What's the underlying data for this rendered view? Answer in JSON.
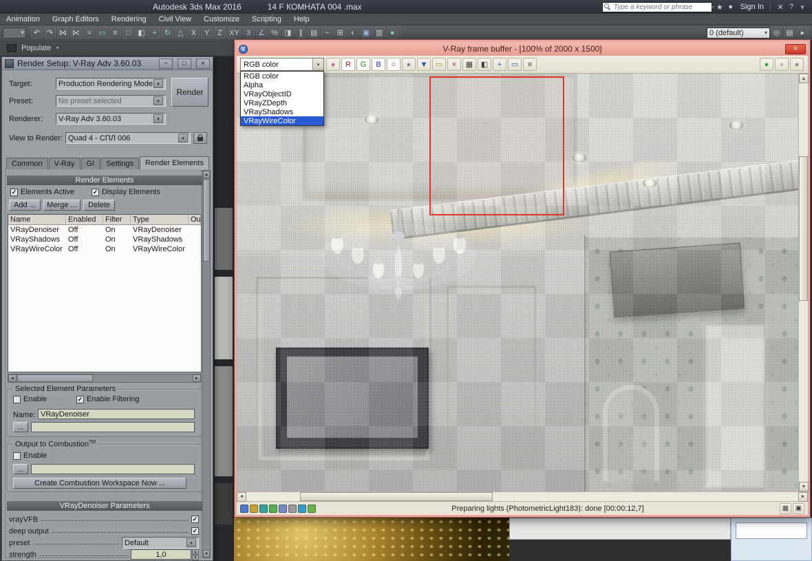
{
  "glyphs": {
    "up": "▲",
    "down": "▼",
    "left": "◄",
    "right": "►",
    "caret": "▾",
    "small_up": "▴",
    "small_down": "▾",
    "check": "✓",
    "minimize": "−",
    "maximize": "□",
    "close": "×"
  },
  "accent_colors": {
    "vfb_frame": "#e7a79e",
    "vfb_titlebar": "#f0aea4",
    "list_highlight": "#2a5ad4",
    "region_outline": "#e23424",
    "close_button": "#d8402e"
  },
  "app": {
    "titlebar": {
      "app_title": "Autodesk 3ds Max 2016",
      "file_title": "14  F КОМНАТА 004 .max",
      "search_placeholder": "Type a keyword or phrase",
      "sign_in": "Sign In",
      "account_icons": [
        {
          "name": "favorites-star-icon",
          "glyph": "★",
          "color": "#c8cdd2"
        },
        {
          "name": "user-icon",
          "glyph": "●",
          "color": "#c8cdd2"
        }
      ],
      "far_icons": [
        {
          "name": "autodesk-a360-icon",
          "glyph": "✕",
          "color": "#c8cdd2"
        },
        {
          "name": "help-icon",
          "glyph": "?",
          "color": "#c8cdd2"
        },
        {
          "name": "help-caret-icon",
          "glyph": "▾",
          "color": "#9aa0a6"
        }
      ]
    },
    "menus": [
      "Animation",
      "Graph Editors",
      "Rendering",
      "Civil View",
      "Customize",
      "Scripting",
      "Help"
    ],
    "toolbar": {
      "layer_combo": "0 (default)",
      "icons": [
        {
          "name": "undo-icon",
          "glyph": "↶"
        },
        {
          "name": "redo-icon",
          "glyph": "↷"
        },
        {
          "name": "select-link-icon",
          "glyph": "⋈"
        },
        {
          "name": "unlink-icon",
          "glyph": "⋉"
        },
        {
          "name": "bind-spacewarp-icon",
          "glyph": "≈"
        },
        {
          "name": "select-object-icon",
          "glyph": "▭",
          "color": "#8fd0cf"
        },
        {
          "name": "select-by-name-icon",
          "glyph": "≡"
        },
        {
          "name": "rect-selection-region-icon",
          "glyph": "□"
        },
        {
          "name": "window-crossing-icon",
          "glyph": "◧"
        },
        {
          "name": "select-move-icon",
          "glyph": "+",
          "color": "#8fd0cf"
        },
        {
          "name": "rotate-icon",
          "glyph": "↻",
          "color": "#8fd0cf"
        },
        {
          "name": "scale-icon",
          "glyph": "△",
          "color": "#8fd0cf"
        },
        {
          "name": "axis-x-button",
          "glyph": "X"
        },
        {
          "name": "axis-y-button",
          "glyph": "Y"
        },
        {
          "name": "axis-z-button",
          "glyph": "Z"
        },
        {
          "name": "axis-xy-button",
          "glyph": "XY"
        },
        {
          "name": "snap-toggle-icon",
          "glyph": "3",
          "color": "#a8c8e8"
        },
        {
          "name": "angle-snap-icon",
          "glyph": "∠",
          "color": "#a8c8e8"
        },
        {
          "name": "percent-snap-icon",
          "glyph": "%"
        },
        {
          "name": "mirror-icon",
          "glyph": "◨"
        },
        {
          "name": "align-icon",
          "glyph": "∥"
        },
        {
          "name": "layer-manager-icon",
          "glyph": "▤"
        },
        {
          "name": "curve-editor-icon",
          "glyph": "~"
        },
        {
          "name": "schematic-view-icon",
          "glyph": "⊞"
        },
        {
          "name": "material-editor-icon",
          "glyph": "◐",
          "color": "#8fd0cf"
        },
        {
          "name": "render-setup-icon",
          "glyph": "▣",
          "color": "#9fb8d8"
        },
        {
          "name": "rendered-frame-window-icon",
          "glyph": "▥"
        },
        {
          "name": "render-production-icon",
          "glyph": "●",
          "color": "#88d4cf"
        }
      ],
      "right_icons": [
        {
          "name": "isolate-selection-icon",
          "glyph": "◎"
        },
        {
          "name": "display-layers-icon",
          "glyph": "▤"
        },
        {
          "name": "prompt-arrow-icon",
          "glyph": "▸"
        }
      ]
    },
    "populate_label": "Populate"
  },
  "render_setup": {
    "title": "Render Setup: V-Ray Adv 3.60.03",
    "target_label": "Target:",
    "target_value": "Production Rendering Mode",
    "preset_label": "Preset:",
    "preset_value": "No preset selected",
    "renderer_label": "Renderer:",
    "renderer_value": "V-Ray Adv 3.60.03",
    "view_label": "View to Render:",
    "view_value": "Quad 4 - СПЛ 006",
    "render_button": "Render",
    "tabs": [
      "Common",
      "V-Ray",
      "GI",
      "Settings",
      "Render Elements"
    ],
    "rollout_elements": "Render Elements",
    "elements_active_label": "Elements Active",
    "display_elements_label": "Display Elements",
    "add_button": "Add ...",
    "merge_button": "Merge ...",
    "delete_button": "Delete",
    "table": {
      "columns": [
        "Name",
        "Enabled",
        "Filter",
        "Type",
        "Ou"
      ],
      "rows": [
        {
          "name": "VRayDenoiser",
          "enabled": "Off",
          "filter": "On",
          "type": "VRayDenoiser"
        },
        {
          "name": "VRayShadows",
          "enabled": "Off",
          "filter": "On",
          "type": "VRayShadows"
        },
        {
          "name": "VRayWireColor",
          "enabled": "Off",
          "filter": "On",
          "type": "VRayWireColor"
        }
      ]
    },
    "selected_group": {
      "title": "Selected Element Parameters",
      "enable_label": "Enable",
      "filtering_label": "Enable Filtering",
      "name_label": "Name:",
      "name_value": "VRayDenoiser",
      "browse_label": "..."
    },
    "combustion_group": {
      "title": "Output to Combustion",
      "tm": "TM",
      "enable_label": "Enable",
      "browse_label": "...",
      "create_button": "Create Combustion Workspace Now ..."
    },
    "rollout_denoiser": "VRayDenoiser Parameters",
    "denoiser": {
      "vrayvfb_label": "vrayVFB",
      "deep_output_label": "deep output",
      "preset_label": "preset",
      "preset_value": "Default",
      "strength_label": "strength",
      "strength_value": "1,0"
    }
  },
  "vfb": {
    "title": "V-Ray frame buffer - [100% of 2000 x 1500]",
    "logo_glyph": "V",
    "channel_combo_value": "RGB color",
    "channel_options": [
      "RGB color",
      "Alpha",
      "VRayObjectID",
      "VRayZDepth",
      "VRayShadows",
      "VRayWireColor"
    ],
    "highlighted_option": "VRayWireColor",
    "status_text": "Preparing lights (PhotometricLight183): done [00:00:12,7]",
    "toolbar_icons": [
      {
        "name": "color-corrections-icon",
        "glyph": "●",
        "color": "#d2688e"
      },
      {
        "name": "red-channel-button",
        "glyph": "R",
        "color": "#b02020",
        "bg": "#ffffff"
      },
      {
        "name": "green-channel-button",
        "glyph": "G",
        "color": "#1e8a1e",
        "bg": "#ffffff"
      },
      {
        "name": "blue-channel-button",
        "glyph": "B",
        "color": "#2030b0",
        "bg": "#ffffff"
      },
      {
        "name": "alpha-channel-button",
        "glyph": "○",
        "color": "#333333",
        "bg": "#ffffff"
      },
      {
        "name": "monochrome-button",
        "glyph": "●",
        "color": "#8a8a8a"
      },
      {
        "name": "save-image-button",
        "glyph": "▼",
        "color": "#2050b0"
      },
      {
        "name": "load-image-button",
        "glyph": "▭",
        "color": "#b08828"
      },
      {
        "name": "clear-image-button",
        "glyph": "×",
        "color": "#c02020"
      },
      {
        "name": "copy-to-clipboard-button",
        "glyph": "▦",
        "color": "#444444"
      },
      {
        "name": "duplicate-to-host-frame-button",
        "glyph": "◧",
        "color": "#444444"
      },
      {
        "name": "track-mouse-while-rendering-button",
        "glyph": "+",
        "color": "#2060c0"
      },
      {
        "name": "region-render-button",
        "glyph": "▭",
        "color": "#2060c0"
      },
      {
        "name": "stamp-button",
        "glyph": "≡",
        "color": "#444444"
      }
    ],
    "toolbar_right_icons": [
      {
        "name": "show-corrections-control-button",
        "glyph": "●",
        "color": "#3aa03a"
      },
      {
        "name": "vfb-settings-button",
        "glyph": "●",
        "color": "#b8b8b8"
      },
      {
        "name": "vfb-help-button",
        "glyph": "●",
        "color": "#8a8a8a"
      }
    ],
    "status_icons": [
      {
        "name": "status-save-all-icon",
        "bg": "#4a7ac8"
      },
      {
        "name": "status-browse-icon",
        "bg": "#c8a23a"
      },
      {
        "name": "status-compare-icon",
        "bg": "#3aa0a0"
      },
      {
        "name": "status-grid-icon",
        "bg": "#58b058"
      },
      {
        "name": "status-copy-icon",
        "bg": "#7a8ac8"
      },
      {
        "name": "status-mono-icon",
        "bg": "#9a9a9a"
      },
      {
        "name": "status-info-icon",
        "bg": "#3a9ac8"
      },
      {
        "name": "status-extra-icon",
        "bg": "#6ab04a"
      }
    ],
    "status_right_icons": [
      {
        "name": "stamp-toggle-icon",
        "glyph": "▦",
        "color": "#444444"
      },
      {
        "name": "fullscreen-icon",
        "glyph": "▣",
        "color": "#444444"
      }
    ]
  }
}
